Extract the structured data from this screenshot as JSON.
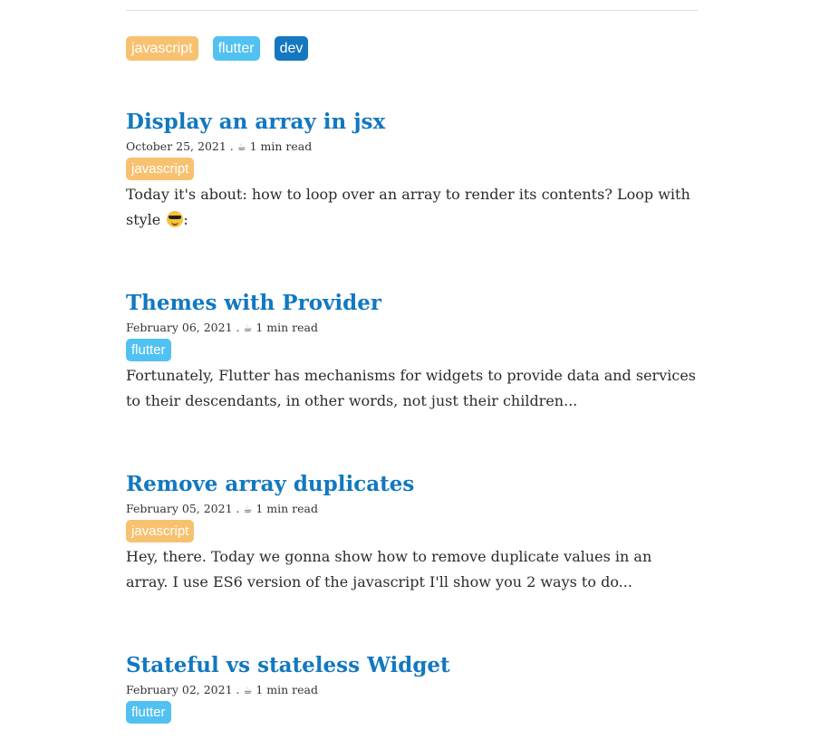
{
  "tag_filters": [
    {
      "label": "javascript",
      "color": "#f8c170"
    },
    {
      "label": "flutter",
      "color": "#51c1f2"
    },
    {
      "label": "dev",
      "color": "#1677c1"
    }
  ],
  "meta_separator": ".",
  "cup_icon": "☕",
  "posts": [
    {
      "title": "Display an array in jsx",
      "date": "October 25, 2021",
      "read_time": "1 min read",
      "tag": "javascript",
      "tag_color": "#f8c170",
      "excerpt": "Today it's about: how to loop over an array to render its contents? Loop with style",
      "excerpt_suffix": ":",
      "emoji": "smiling-face-with-sunglasses"
    },
    {
      "title": "Themes with Provider",
      "date": "February 06, 2021",
      "read_time": "1 min read",
      "tag": "flutter",
      "tag_color": "#51c1f2",
      "excerpt": "Fortunately, Flutter has mechanisms for widgets to provide data and services to their descendants, in other words, not just their children..."
    },
    {
      "title": "Remove array duplicates",
      "date": "February 05, 2021",
      "read_time": "1 min read",
      "tag": "javascript",
      "tag_color": "#f8c170",
      "excerpt": "Hey, there. Today we gonna show how to remove duplicate values in an array. I use ES6 version of the javascript I'll show you 2 ways to do..."
    },
    {
      "title": "Stateful vs stateless Widget",
      "date": "February 02, 2021",
      "read_time": "1 min read",
      "tag": "flutter",
      "tag_color": "#51c1f2"
    }
  ]
}
